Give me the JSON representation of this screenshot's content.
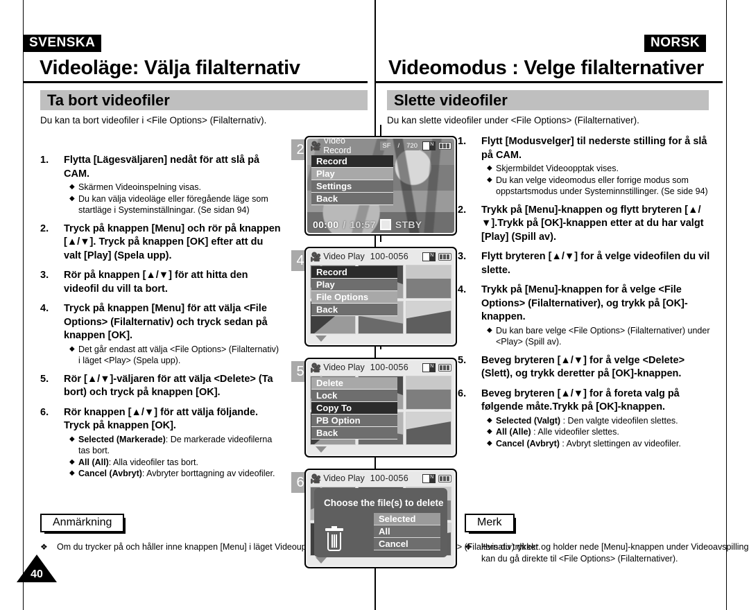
{
  "left": {
    "lang_tag": "SVENSKA",
    "chapter_title": "Videoläge: Välja filalternativ",
    "section_title": "Ta bort videofiler",
    "intro": "Du kan ta bort videofiler i <File Options> (Filalternativ).",
    "steps": [
      {
        "num": "1.",
        "main": "Flytta [Lägesväljaren] nedåt för att slå på CAM.",
        "bullets": [
          "Skärmen Videoinspelning visas.",
          "Du kan välja videoläge eller föregående läge som startläge i Systeminställningar.  (Se sidan 94)"
        ]
      },
      {
        "num": "2.",
        "main": "Tryck på knappen [Menu] och rör på knappen [▲/▼]. Tryck på knappen [OK] efter att du valt [Play] (Spela upp).",
        "bullets": []
      },
      {
        "num": "3.",
        "main": "Rör på knappen [▲/▼] för att hitta den videofil du vill ta bort.",
        "bullets": []
      },
      {
        "num": "4.",
        "main": "Tryck på knappen [Menu] för att välja <File Options> (Filalternativ) och tryck sedan på knappen [OK].",
        "bullets": [
          "Det går endast att välja <File Options> (Filalternativ) i läget <Play> (Spela upp)."
        ]
      },
      {
        "num": "5.",
        "main": "Rör [▲/▼]-väljaren för att välja <Delete> (Ta bort) och tryck på knappen [OK].",
        "bullets": []
      },
      {
        "num": "6.",
        "main": "Rör knappen [▲/▼] för att välja följande. Tryck på knappen [OK].",
        "bullets_rich": [
          {
            "b": "Selected (Markerade)",
            "t": ": De markerade videofilerna tas bort."
          },
          {
            "b": "All (All)",
            "t": ": Alla videofiler tas bort."
          },
          {
            "b": "Cancel (Avbryt)",
            "t": ": Avbryter borttagning av videofiler."
          }
        ]
      }
    ],
    "note_label": "Anmärkning",
    "note_text": "Om du trycker på och håller inne knappen [Menu] i läget Videouppspelning kan du flytta till <File Options> (Filalternativ) direkt."
  },
  "right": {
    "lang_tag": "NORSK",
    "chapter_title": "Videomodus : Velge filalternativer",
    "section_title": "Slette videofiler",
    "intro": "Du kan slette videofiler under <File Options> (Filalternativer).",
    "steps": [
      {
        "num": "1.",
        "main": "Flytt [Modusvelger] til nederste stilling for å slå på CAM.",
        "bullets": [
          "Skjermbildet Videoopptak vises.",
          "Du kan velge videomodus eller forrige modus som oppstartsmodus under Systeminnstillinger. (Se side 94)"
        ]
      },
      {
        "num": "2.",
        "main": "Trykk på [Menu]-knappen og flytt bryteren [▲/▼].Trykk på [OK]-knappen etter at du har valgt [Play] (Spill av).",
        "bullets": []
      },
      {
        "num": "3.",
        "main": "Flytt bryteren [▲/▼] for å velge videofilen du vil slette.",
        "bullets": []
      },
      {
        "num": "4.",
        "main": "Trykk på [Menu]-knappen for å velge <File Options> (Filalternativer), og trykk på [OK]-knappen.",
        "bullets": [
          "Du kan bare velge <File Options> (Filalternativer) under <Play> (Spill av)."
        ]
      },
      {
        "num": "5.",
        "main": "Beveg bryteren [▲/▼] for å velge <Delete> (Slett), og trykk deretter på [OK]-knappen.",
        "bullets": []
      },
      {
        "num": "6.",
        "main": "Beveg bryteren [▲/▼] for å foreta valg på følgende måte.Trykk på [OK]-knappen.",
        "bullets_rich": [
          {
            "b": "Selected (Valgt)",
            "t": " : Den valgte videofilen slettes."
          },
          {
            "b": "All (Alle)",
            "t": " : Alle videofiler slettes."
          },
          {
            "b": "Cancel (Avbryt)",
            "t": " : Avbryt slettingen av videofiler."
          }
        ]
      }
    ],
    "note_label": "Merk",
    "note_text": "Hvis du trykker og holder nede [Menu]-knappen under Videoavspilling kan du gå direkte til <File Options> (Filalternativer)."
  },
  "page_number": "40",
  "screens": [
    {
      "badge": "2",
      "title": "Video Record",
      "quality": "SF",
      "quality_sep": "/",
      "resolution": "720",
      "card_label": "N",
      "menu": [
        {
          "label": "Record",
          "state": "selected-dark"
        },
        {
          "label": "Play",
          "state": "normal-light"
        },
        {
          "label": "Settings",
          "state": "normal"
        },
        {
          "label": "Back",
          "state": "normal"
        }
      ],
      "rec_elapsed": "00:00",
      "rec_sep": "/",
      "rec_total": "10:57",
      "rec_status": "STBY"
    },
    {
      "badge": "4",
      "title": "Video Play",
      "file_no": "100-0056",
      "card_label": "N",
      "menu": [
        {
          "label": "Record",
          "state": "selected-dark"
        },
        {
          "label": "Play",
          "state": "normal"
        },
        {
          "label": "File Options",
          "state": "normal-light"
        },
        {
          "label": "Back",
          "state": "normal"
        }
      ]
    },
    {
      "badge": "5",
      "title": "Video Play",
      "file_no": "100-0056",
      "card_label": "N",
      "menu": [
        {
          "label": "Delete",
          "state": "normal-light"
        },
        {
          "label": "Lock",
          "state": "normal"
        },
        {
          "label": "Copy To",
          "state": "selected-dark"
        },
        {
          "label": "PB Option",
          "state": "normal"
        },
        {
          "label": "Back",
          "state": "normal"
        }
      ]
    },
    {
      "badge": "6",
      "title": "Video Play",
      "file_no": "100-0056",
      "card_label": "N",
      "dialog_title": "Choose the file(s) to delete",
      "dialog_buttons": [
        {
          "label": "Selected",
          "state": "highlight"
        },
        {
          "label": "All",
          "state": "normal"
        },
        {
          "label": "Cancel",
          "state": "normal"
        }
      ]
    }
  ],
  "colors": {
    "accent_grey": "#bfbfbf",
    "menu_bg": "#6e6e6e",
    "menu_selected": "#2b2b2b",
    "menu_light": "#a8a8a8",
    "badge_bg": "#a9a9a9",
    "dialog_bg": "#5f5f5f"
  }
}
